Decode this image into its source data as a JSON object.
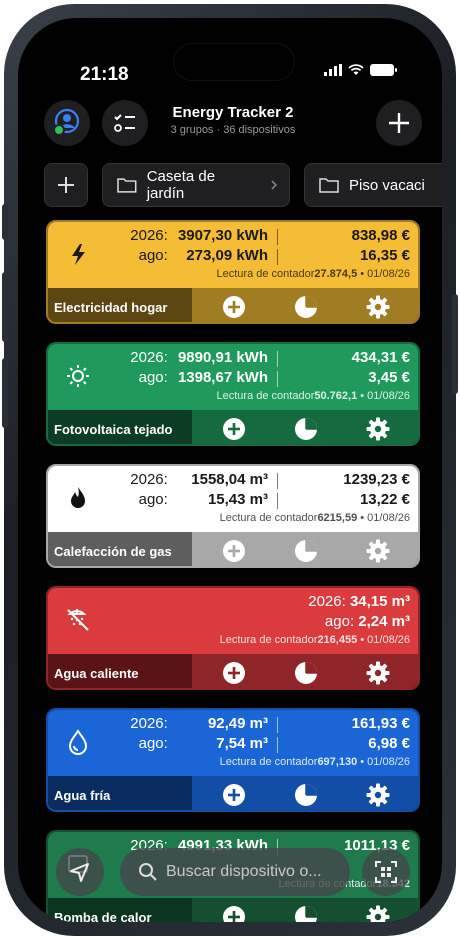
{
  "status": {
    "time": "21:18"
  },
  "header": {
    "title": "Energy Tracker 2",
    "subtitle": "3 grupos · 36 dispositivos"
  },
  "groups": [
    {
      "label": "Caseta de jardín"
    },
    {
      "label": "Piso vacaci"
    }
  ],
  "search": {
    "placeholder": "Buscar dispositivo o..."
  },
  "cards": [
    {
      "name": "Electricidad hogar",
      "icon": "lightning-icon",
      "year_label": "2026:",
      "year_value": "3907,30 kWh",
      "year_cost": "838,98 €",
      "prev_label": "ago:",
      "prev_value": "273,09 kWh",
      "prev_cost": "16,35 €",
      "meter_label": "Lectura de contador",
      "meter_value": "27.874,5",
      "meter_date": " • 01/08/26",
      "colors": {
        "top": "#f4bd35",
        "bottom": "#a07c22",
        "name_bg": "#5c4713",
        "text": "#1a1a1a"
      }
    },
    {
      "name": "Fotovoltaica tejado",
      "icon": "sun-icon",
      "year_label": "2026:",
      "year_value": "9890,91 kWh",
      "year_cost": "434,31 €",
      "prev_label": "ago:",
      "prev_value": "1398,67 kWh",
      "prev_cost": "3,45 €",
      "meter_label": "Lectura de contador",
      "meter_value": "50.762,1",
      "meter_date": " • 01/08/26",
      "colors": {
        "top": "#1f9a5c",
        "bottom": "#166a40",
        "name_bg": "#0c3d24",
        "text": "#ffffff"
      }
    },
    {
      "name": "Calefacción de gas",
      "icon": "flame-icon",
      "year_label": "2026:",
      "year_value": "1558,04 m³",
      "year_cost": "1239,23 €",
      "prev_label": "ago:",
      "prev_value": "15,43 m³",
      "prev_cost": "13,22 €",
      "meter_label": "Lectura de contador",
      "meter_value": "6215,59",
      "meter_date": " • 01/08/26",
      "colors": {
        "top": "#ffffff",
        "bottom": "#a8a8a8",
        "name_bg": "#5e5e5e",
        "text": "#1a1a1a"
      }
    },
    {
      "name": "Agua caliente",
      "icon": "shower-icon",
      "year_label": "2026:",
      "year_value": "34,15 m³",
      "year_cost": "",
      "prev_label": "ago:",
      "prev_value": "2,24 m³",
      "prev_cost": "",
      "meter_label": "Lectura de contador",
      "meter_value": "216,455",
      "meter_date": " • 01/08/26",
      "colors": {
        "top": "#dc3b3e",
        "bottom": "#8e2528",
        "name_bg": "#5a1416",
        "text": "#ffffff"
      }
    },
    {
      "name": "Agua fría",
      "icon": "water-drop-icon",
      "year_label": "2026:",
      "year_value": "92,49 m³",
      "year_cost": "161,93 €",
      "prev_label": "ago:",
      "prev_value": "7,54 m³",
      "prev_cost": "6,98 €",
      "meter_label": "Lectura de contador",
      "meter_value": "697,130",
      "meter_date": " • 01/08/26",
      "colors": {
        "top": "#1a66d6",
        "bottom": "#124ea6",
        "name_bg": "#0a2c60",
        "text": "#ffffff"
      }
    },
    {
      "name": "Bomba de calor",
      "icon": "heat-pump-icon",
      "year_label": "2026:",
      "year_value": "4991,33 kWh",
      "year_cost": "1011,13 €",
      "prev_label": "",
      "prev_value": "",
      "prev_cost": "",
      "meter_label": "Lectura de contador",
      "meter_value": "18.342",
      "meter_date": "",
      "colors": {
        "top": "#1f7a4c",
        "bottom": "#14502f",
        "name_bg": "#0c3520",
        "text": "#ffffff"
      }
    }
  ]
}
